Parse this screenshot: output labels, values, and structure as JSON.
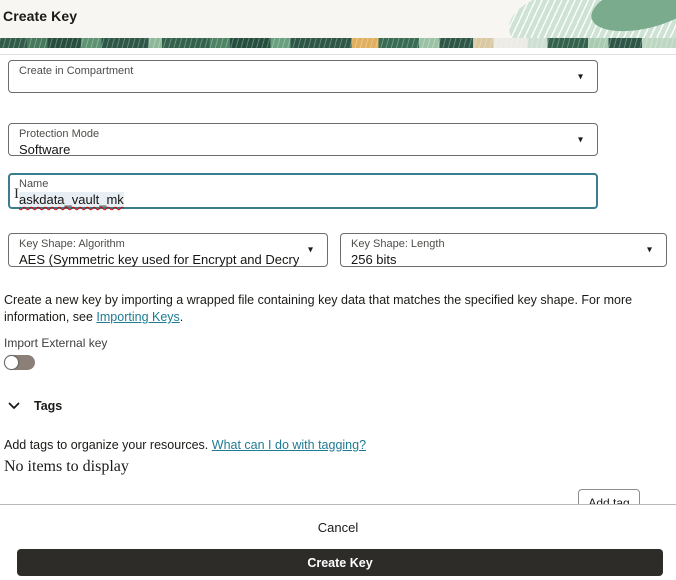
{
  "title": "Create Key",
  "form": {
    "compartment": {
      "label": "Create in Compartment",
      "value": "",
      "redacted": true
    },
    "protection_mode": {
      "label": "Protection Mode",
      "value": "Software"
    },
    "name": {
      "label": "Name",
      "value": "askdata_vault_mk"
    },
    "key_shape_algorithm": {
      "label": "Key Shape: Algorithm",
      "value": "AES (Symmetric key used for Encrypt and Decrypt)"
    },
    "key_shape_length": {
      "label": "Key Shape: Length",
      "value": "256 bits"
    },
    "import_info": {
      "text": "Create a new key by importing a wrapped file containing key data that matches the specified key shape. For more information, see ",
      "link_text": "Importing Keys",
      "suffix": "."
    },
    "import_external": {
      "label": "Import External key",
      "toggle_state": "off"
    }
  },
  "tags": {
    "section_title": "Tags",
    "description": "Add tags to organize your resources. ",
    "link_text": "What can I do with tagging?",
    "empty_message": "No items to display",
    "add_button_label": "Add tag"
  },
  "footer": {
    "cancel_label": "Cancel",
    "submit_label": "Create Key"
  },
  "icons": {
    "caret_down": "▾",
    "text_cursor": "I"
  },
  "colors": {
    "header_bg": "#f8f6f2",
    "banner_green_dark": "#2e5748",
    "banner_green_mid": "#5d9273",
    "banner_mint": "#cfe3d4",
    "banner_gold": "#e0b061",
    "focus_border": "#3a7d8f",
    "link": "#1e7b93",
    "field_border": "#6f6d6a",
    "toggle_track": "#8b7f78",
    "spellcheck_underline": "#d40000",
    "primary_button_bg": "#2e2c29",
    "primary_button_text": "#ffffff"
  }
}
